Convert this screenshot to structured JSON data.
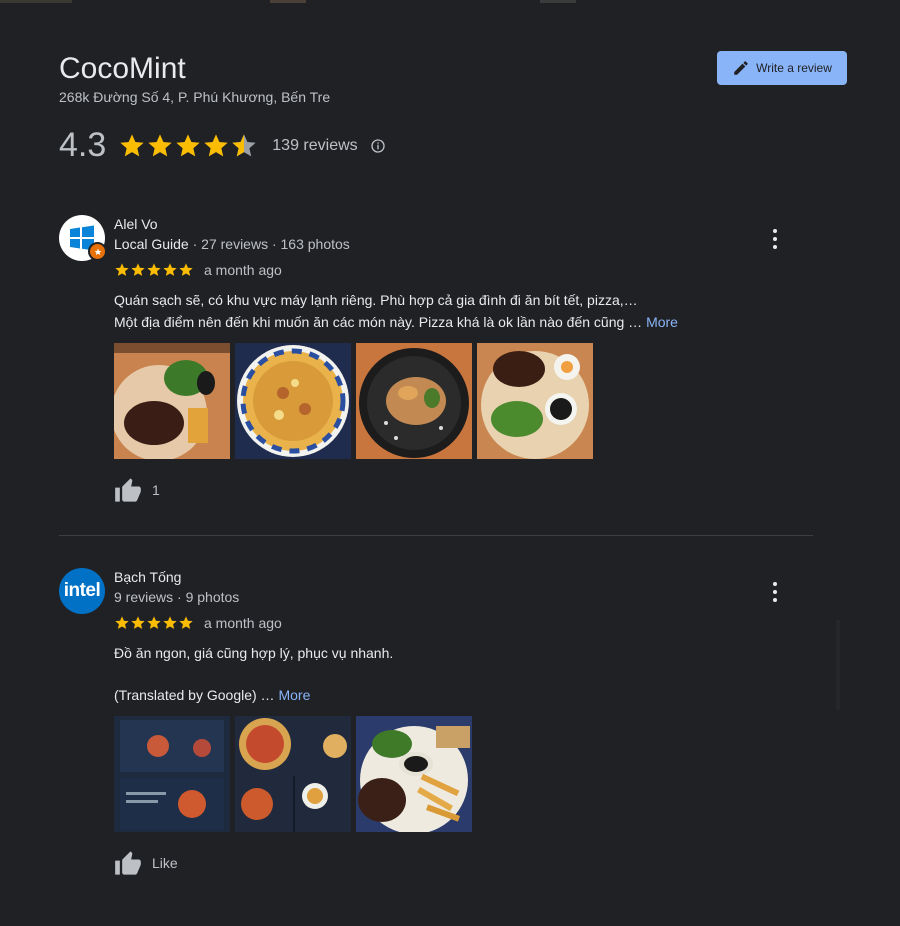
{
  "place": {
    "name": "CocoMint",
    "address": "268k Đường Số 4, P. Phú Khương, Bến Tre",
    "rating": "4.3",
    "rating_value": 4.3,
    "reviews_count": "139 reviews"
  },
  "header": {
    "write_review_label": "Write a review"
  },
  "colors": {
    "background": "#202124",
    "star": "#fbbc04",
    "link": "#8ab4f8",
    "button_bg": "#8ab4f8"
  },
  "reviews": [
    {
      "name": "Alel Vo",
      "local_guide": "Local Guide",
      "meta": " · 27 reviews · 163 photos",
      "avatar_icon": "windows-logo-icon",
      "stars": 5,
      "date": "a month ago",
      "text_line1": "Quán sạch sẽ, có khu vực máy lạnh riêng. Phù hợp cả gia đình đi ăn bít tết, pizza,…",
      "text_line2": "Một địa điểm nên đến khi muốn ăn các món này. Pizza khá là ok lần nào đến cũng …",
      "more_label": "More",
      "photos": [
        "steak-plate-photo",
        "pizza-photo",
        "pasta-photo",
        "steak-salad-photo"
      ],
      "likes": "1"
    },
    {
      "name": "Bạch Tống",
      "meta": "9 reviews · 9 photos",
      "avatar_label": "intel",
      "stars": 5,
      "date": "a month ago",
      "text_line1": "Đồ ăn ngon, giá cũng hợp lý, phục vụ nhanh.",
      "text_line2": "(Translated by Google) …",
      "more_label": "More",
      "photos": [
        "menu-photo-1",
        "menu-photo-2",
        "steak-fries-photo"
      ],
      "likes": "Like"
    }
  ]
}
